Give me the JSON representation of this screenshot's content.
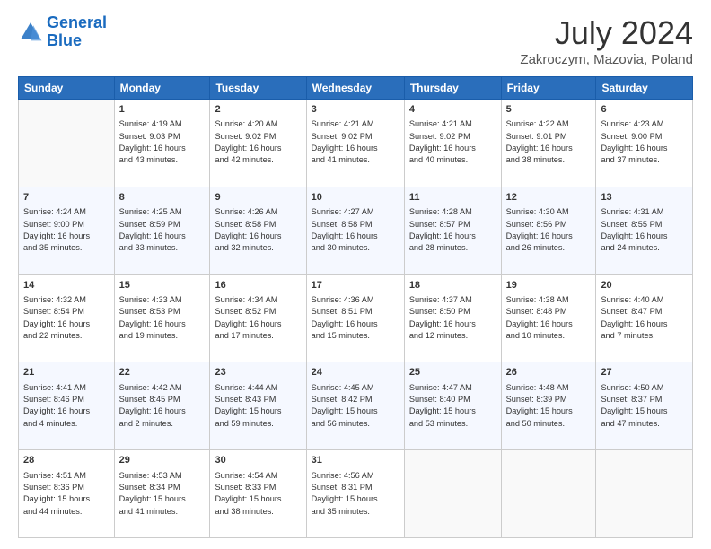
{
  "logo": {
    "line1": "General",
    "line2": "Blue"
  },
  "title": "July 2024",
  "location": "Zakroczym, Mazovia, Poland",
  "days_of_week": [
    "Sunday",
    "Monday",
    "Tuesday",
    "Wednesday",
    "Thursday",
    "Friday",
    "Saturday"
  ],
  "weeks": [
    [
      {
        "num": "",
        "info": ""
      },
      {
        "num": "1",
        "info": "Sunrise: 4:19 AM\nSunset: 9:03 PM\nDaylight: 16 hours\nand 43 minutes."
      },
      {
        "num": "2",
        "info": "Sunrise: 4:20 AM\nSunset: 9:02 PM\nDaylight: 16 hours\nand 42 minutes."
      },
      {
        "num": "3",
        "info": "Sunrise: 4:21 AM\nSunset: 9:02 PM\nDaylight: 16 hours\nand 41 minutes."
      },
      {
        "num": "4",
        "info": "Sunrise: 4:21 AM\nSunset: 9:02 PM\nDaylight: 16 hours\nand 40 minutes."
      },
      {
        "num": "5",
        "info": "Sunrise: 4:22 AM\nSunset: 9:01 PM\nDaylight: 16 hours\nand 38 minutes."
      },
      {
        "num": "6",
        "info": "Sunrise: 4:23 AM\nSunset: 9:00 PM\nDaylight: 16 hours\nand 37 minutes."
      }
    ],
    [
      {
        "num": "7",
        "info": "Sunrise: 4:24 AM\nSunset: 9:00 PM\nDaylight: 16 hours\nand 35 minutes."
      },
      {
        "num": "8",
        "info": "Sunrise: 4:25 AM\nSunset: 8:59 PM\nDaylight: 16 hours\nand 33 minutes."
      },
      {
        "num": "9",
        "info": "Sunrise: 4:26 AM\nSunset: 8:58 PM\nDaylight: 16 hours\nand 32 minutes."
      },
      {
        "num": "10",
        "info": "Sunrise: 4:27 AM\nSunset: 8:58 PM\nDaylight: 16 hours\nand 30 minutes."
      },
      {
        "num": "11",
        "info": "Sunrise: 4:28 AM\nSunset: 8:57 PM\nDaylight: 16 hours\nand 28 minutes."
      },
      {
        "num": "12",
        "info": "Sunrise: 4:30 AM\nSunset: 8:56 PM\nDaylight: 16 hours\nand 26 minutes."
      },
      {
        "num": "13",
        "info": "Sunrise: 4:31 AM\nSunset: 8:55 PM\nDaylight: 16 hours\nand 24 minutes."
      }
    ],
    [
      {
        "num": "14",
        "info": "Sunrise: 4:32 AM\nSunset: 8:54 PM\nDaylight: 16 hours\nand 22 minutes."
      },
      {
        "num": "15",
        "info": "Sunrise: 4:33 AM\nSunset: 8:53 PM\nDaylight: 16 hours\nand 19 minutes."
      },
      {
        "num": "16",
        "info": "Sunrise: 4:34 AM\nSunset: 8:52 PM\nDaylight: 16 hours\nand 17 minutes."
      },
      {
        "num": "17",
        "info": "Sunrise: 4:36 AM\nSunset: 8:51 PM\nDaylight: 16 hours\nand 15 minutes."
      },
      {
        "num": "18",
        "info": "Sunrise: 4:37 AM\nSunset: 8:50 PM\nDaylight: 16 hours\nand 12 minutes."
      },
      {
        "num": "19",
        "info": "Sunrise: 4:38 AM\nSunset: 8:48 PM\nDaylight: 16 hours\nand 10 minutes."
      },
      {
        "num": "20",
        "info": "Sunrise: 4:40 AM\nSunset: 8:47 PM\nDaylight: 16 hours\nand 7 minutes."
      }
    ],
    [
      {
        "num": "21",
        "info": "Sunrise: 4:41 AM\nSunset: 8:46 PM\nDaylight: 16 hours\nand 4 minutes."
      },
      {
        "num": "22",
        "info": "Sunrise: 4:42 AM\nSunset: 8:45 PM\nDaylight: 16 hours\nand 2 minutes."
      },
      {
        "num": "23",
        "info": "Sunrise: 4:44 AM\nSunset: 8:43 PM\nDaylight: 15 hours\nand 59 minutes."
      },
      {
        "num": "24",
        "info": "Sunrise: 4:45 AM\nSunset: 8:42 PM\nDaylight: 15 hours\nand 56 minutes."
      },
      {
        "num": "25",
        "info": "Sunrise: 4:47 AM\nSunset: 8:40 PM\nDaylight: 15 hours\nand 53 minutes."
      },
      {
        "num": "26",
        "info": "Sunrise: 4:48 AM\nSunset: 8:39 PM\nDaylight: 15 hours\nand 50 minutes."
      },
      {
        "num": "27",
        "info": "Sunrise: 4:50 AM\nSunset: 8:37 PM\nDaylight: 15 hours\nand 47 minutes."
      }
    ],
    [
      {
        "num": "28",
        "info": "Sunrise: 4:51 AM\nSunset: 8:36 PM\nDaylight: 15 hours\nand 44 minutes."
      },
      {
        "num": "29",
        "info": "Sunrise: 4:53 AM\nSunset: 8:34 PM\nDaylight: 15 hours\nand 41 minutes."
      },
      {
        "num": "30",
        "info": "Sunrise: 4:54 AM\nSunset: 8:33 PM\nDaylight: 15 hours\nand 38 minutes."
      },
      {
        "num": "31",
        "info": "Sunrise: 4:56 AM\nSunset: 8:31 PM\nDaylight: 15 hours\nand 35 minutes."
      },
      {
        "num": "",
        "info": ""
      },
      {
        "num": "",
        "info": ""
      },
      {
        "num": "",
        "info": ""
      }
    ]
  ]
}
